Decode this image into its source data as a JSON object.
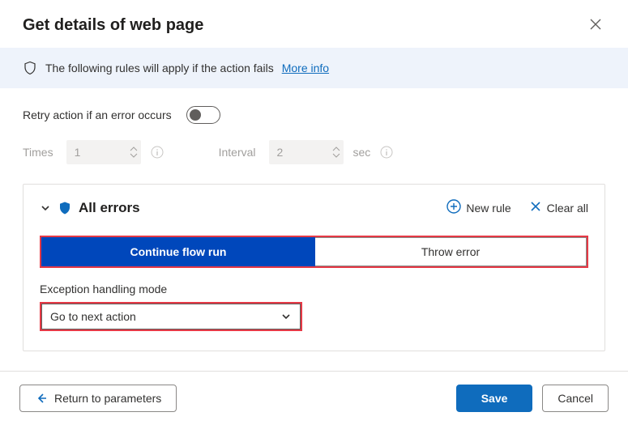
{
  "dialog": {
    "title": "Get details of web page"
  },
  "banner": {
    "text": "The following rules will apply if the action fails",
    "link_text": "More info"
  },
  "retry": {
    "label": "Retry action if an error occurs",
    "times_label": "Times",
    "times_value": "1",
    "interval_label": "Interval",
    "interval_value": "2",
    "interval_unit": "sec"
  },
  "errors": {
    "title": "All errors",
    "new_rule": "New rule",
    "clear_all": "Clear all",
    "segments": {
      "continue": "Continue flow run",
      "throw": "Throw error"
    },
    "mode_label": "Exception handling mode",
    "mode_value": "Go to next action"
  },
  "footer": {
    "back": "Return to parameters",
    "save": "Save",
    "cancel": "Cancel"
  }
}
